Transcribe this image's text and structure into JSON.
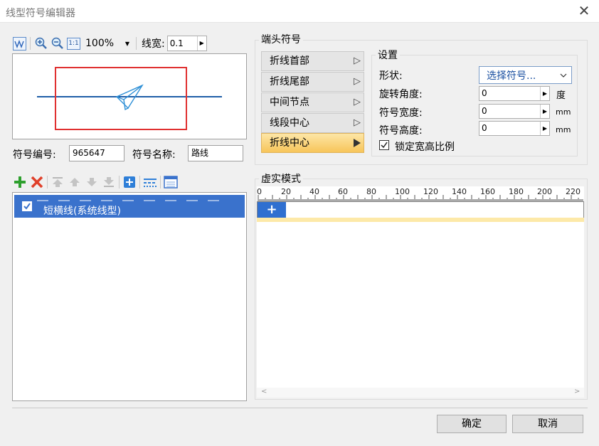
{
  "window": {
    "title": "线型符号编辑器",
    "close_glyph": "✕"
  },
  "toolbar": {
    "icons": [
      "line-preview-icon",
      "zoom-in-icon",
      "zoom-out-icon",
      "actual-size-icon"
    ],
    "actual_size_label": "1:1",
    "zoom_value": "100%",
    "linewidth_label": "线宽:",
    "linewidth_value": "0.1"
  },
  "symbol": {
    "id_label": "符号编号:",
    "id_value": "965647",
    "name_label": "符号名称:",
    "name_value": "路线"
  },
  "list_toolbar": {
    "icons": [
      "add-icon",
      "delete-icon",
      "move-top-icon",
      "move-up-icon",
      "move-down-icon",
      "move-bottom-icon",
      "insert-icon",
      "dash-style-icon",
      "properties-icon"
    ]
  },
  "list": {
    "items": [
      {
        "label": "短横线(系统线型)",
        "checked": true,
        "selected": true
      }
    ]
  },
  "end_symbol": {
    "group_title": "端头符号",
    "tabs": [
      "折线首部",
      "折线尾部",
      "中间节点",
      "线段中心",
      "折线中心"
    ],
    "active_tab": 4
  },
  "settings": {
    "group_title": "设置",
    "shape_label": "形状:",
    "shape_value": "选择符号...",
    "rotation_label": "旋转角度:",
    "rotation_value": "0",
    "rotation_unit": "度",
    "width_label": "符号宽度:",
    "width_value": "0",
    "width_unit": "mm",
    "height_label": "符号高度:",
    "height_value": "0",
    "height_unit": "mm",
    "lock_label": "锁定宽高比例",
    "lock_checked": true
  },
  "dash_mode": {
    "group_title": "虚实模式",
    "ruler_ticks": [
      "0",
      "20",
      "40",
      "60",
      "80",
      "100",
      "120",
      "140",
      "160",
      "180",
      "200",
      "220"
    ],
    "add_glyph": "+"
  },
  "footer": {
    "ok_label": "确定",
    "cancel_label": "取消"
  },
  "colors": {
    "selection": "#3a72cc",
    "active_tab": "#f7c55a",
    "preview_line": "#1f5ea8",
    "preview_box": "#e03030",
    "plane": "#2d8fd6"
  }
}
